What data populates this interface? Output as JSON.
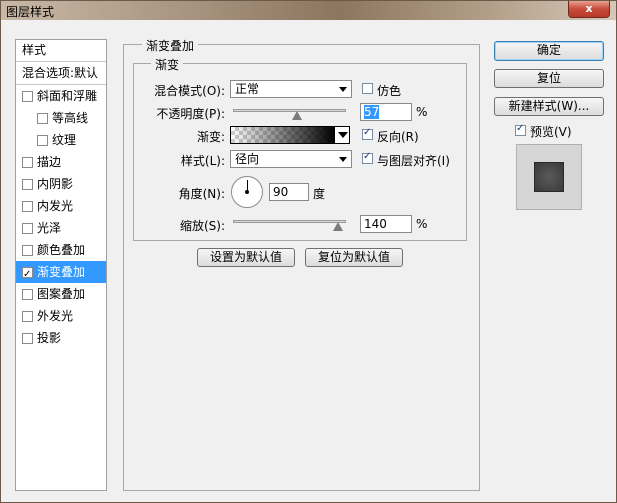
{
  "window": {
    "title": "图层样式",
    "close": "x"
  },
  "sidebar": {
    "header": "样式",
    "blend_options": "混合选项:默认",
    "items": [
      {
        "label": "斜面和浮雕",
        "checked": false
      },
      {
        "label": "等高线",
        "checked": false
      },
      {
        "label": "纹理",
        "checked": false
      },
      {
        "label": "描边",
        "checked": false
      },
      {
        "label": "内阴影",
        "checked": false
      },
      {
        "label": "内发光",
        "checked": false
      },
      {
        "label": "光泽",
        "checked": false
      },
      {
        "label": "颜色叠加",
        "checked": false
      },
      {
        "label": "渐变叠加",
        "checked": true
      },
      {
        "label": "图案叠加",
        "checked": false
      },
      {
        "label": "外发光",
        "checked": false
      },
      {
        "label": "投影",
        "checked": false
      }
    ]
  },
  "panel": {
    "title": "渐变叠加",
    "group_title": "渐变",
    "blend_mode": {
      "label": "混合模式(O):",
      "value": "正常"
    },
    "dither": {
      "label": "仿色",
      "checked": false
    },
    "opacity": {
      "label": "不透明度(P):",
      "value": "57",
      "unit": "%",
      "fraction": 0.57
    },
    "gradient": {
      "label": "渐变:",
      "start_color": "#000000",
      "end_color": "#000000"
    },
    "reverse": {
      "label": "反向(R)",
      "checked": true
    },
    "style": {
      "label": "样式(L):",
      "value": "径向"
    },
    "align_layer": {
      "label": "与图层对齐(I)",
      "checked": true
    },
    "angle": {
      "label": "角度(N):",
      "value": "90",
      "unit": "度"
    },
    "scale": {
      "label": "缩放(S):",
      "value": "140",
      "unit": "%",
      "fraction": 0.93
    },
    "make_default": "设置为默认值",
    "reset_default": "复位为默认值"
  },
  "actions": {
    "ok": "确定",
    "reset": "复位",
    "new_style": "新建样式(W)...",
    "preview": {
      "label": "预览(V)",
      "checked": true
    }
  },
  "colors": {
    "selection": "#3399ff",
    "window_bg": "#f0f0f0"
  }
}
